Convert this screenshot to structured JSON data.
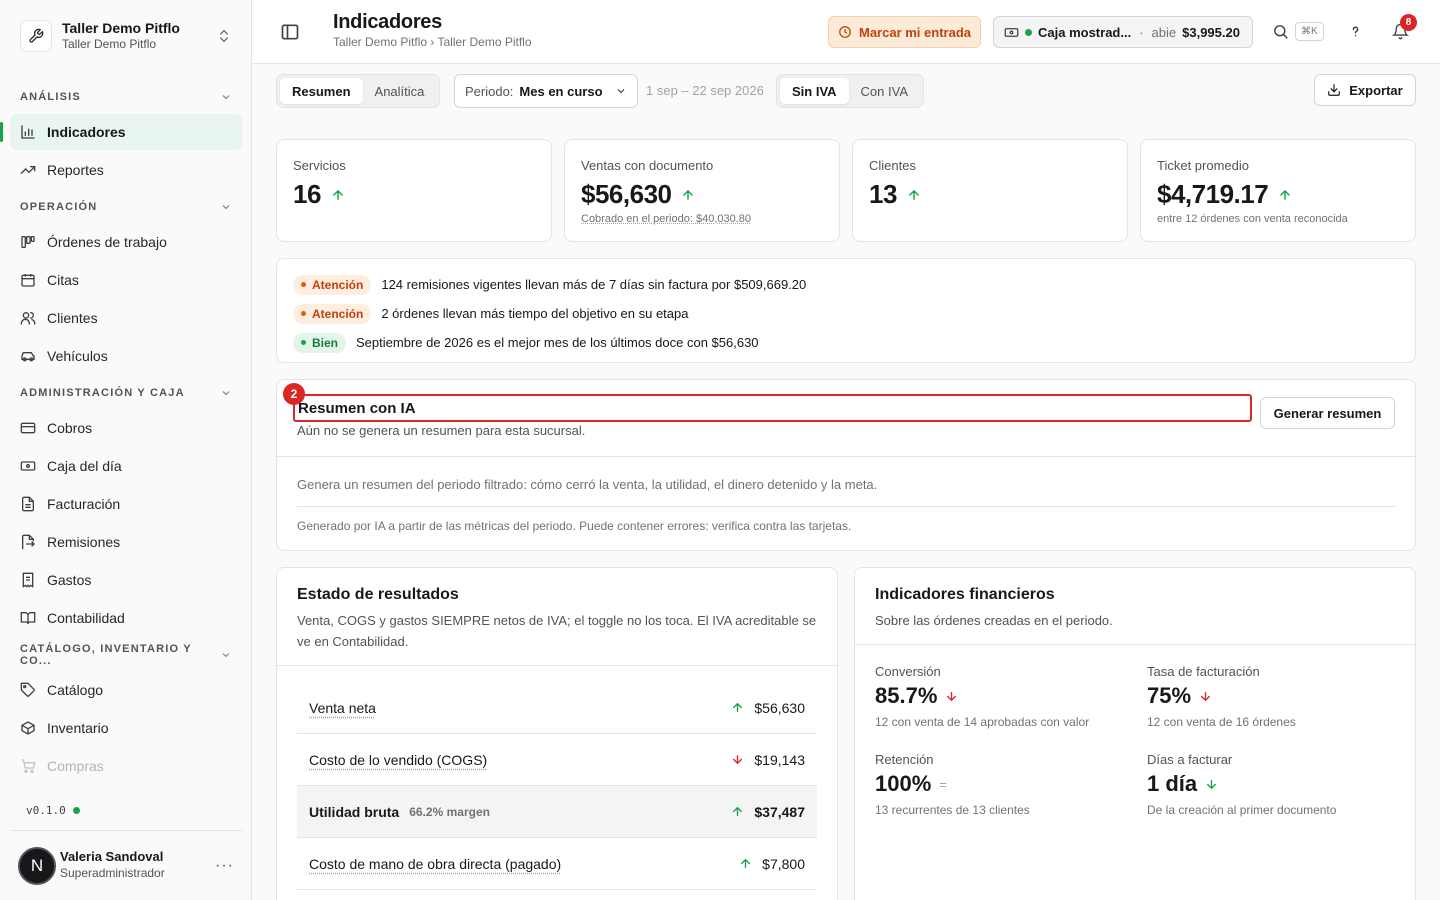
{
  "workspace": {
    "name": "Taller Demo Pitflo",
    "subtitle": "Taller Demo Pitflo"
  },
  "sidebar": {
    "sections": [
      {
        "label": "ANÁLISIS",
        "items": [
          {
            "label": "Indicadores",
            "icon": "bar-chart-icon",
            "active": true
          },
          {
            "label": "Reportes",
            "icon": "trending-up-icon"
          }
        ]
      },
      {
        "label": "OPERACIÓN",
        "items": [
          {
            "label": "Órdenes de trabajo",
            "icon": "kanban-icon"
          },
          {
            "label": "Citas",
            "icon": "calendar-icon"
          },
          {
            "label": "Clientes",
            "icon": "users-icon"
          },
          {
            "label": "Vehículos",
            "icon": "car-icon"
          }
        ]
      },
      {
        "label": "ADMINISTRACIÓN Y CAJA",
        "items": [
          {
            "label": "Cobros",
            "icon": "credit-card-icon"
          },
          {
            "label": "Caja del día",
            "icon": "banknote-icon"
          },
          {
            "label": "Facturación",
            "icon": "file-text-icon"
          },
          {
            "label": "Remisiones",
            "icon": "file-export-icon"
          },
          {
            "label": "Gastos",
            "icon": "receipt-icon"
          },
          {
            "label": "Contabilidad",
            "icon": "book-icon"
          }
        ]
      },
      {
        "label": "CATÁLOGO, INVENTARIO Y CO...",
        "items": [
          {
            "label": "Catálogo",
            "icon": "tag-icon"
          },
          {
            "label": "Inventario",
            "icon": "package-icon"
          },
          {
            "label": "Compras",
            "icon": "cart-icon"
          }
        ]
      }
    ],
    "version": "v0.1.0",
    "user": {
      "initial": "N",
      "name": "Valeria Sandoval",
      "role": "Superadministrador"
    }
  },
  "header": {
    "title": "Indicadores",
    "breadcrumb": "Taller Demo Pitflo › Taller Demo Pitflo",
    "entry_button": "Marcar mi entrada",
    "caja": {
      "name": "Caja mostrad...",
      "separator": "·",
      "status": "abie",
      "amount": "$3,995.20"
    },
    "shortcut": "⌘K",
    "notifications": "8"
  },
  "toolbar": {
    "view_tabs": [
      "Resumen",
      "Analítica"
    ],
    "period_label": "Periodo:",
    "period_value": "Mes en curso",
    "date_range": "1 sep – 22 sep 2026",
    "tax_tabs": [
      "Sin IVA",
      "Con IVA"
    ],
    "export_label": "Exportar"
  },
  "kpis": [
    {
      "label": "Servicios",
      "value": "16",
      "trend": "up",
      "sub": ""
    },
    {
      "label": "Ventas con documento",
      "value": "$56,630",
      "trend": "up",
      "sub": "Cobrado en el periodo: $40,030.80"
    },
    {
      "label": "Clientes",
      "value": "13",
      "trend": "up",
      "sub": ""
    },
    {
      "label": "Ticket promedio",
      "value": "$4,719.17",
      "trend": "up",
      "sub": "entre 12 órdenes con venta reconocida"
    }
  ],
  "alerts": [
    {
      "level": "Atención",
      "kind": "warn",
      "text": "124 remisiones vigentes llevan más de 7 días sin factura por $509,669.20"
    },
    {
      "level": "Atención",
      "kind": "warn",
      "text": "2 órdenes llevan más tiempo del objetivo en su etapa"
    },
    {
      "level": "Bien",
      "kind": "ok",
      "text": "Septiembre de 2026 es el mejor mes de los últimos doce con $56,630"
    }
  ],
  "ai_summary": {
    "marker": "2",
    "title": "Resumen con IA",
    "subtitle": "Aún no se genera un resumen para esta sucursal.",
    "button": "Generar resumen",
    "description": "Genera un resumen del periodo filtrado: cómo cerró la venta, la utilidad, el dinero detenido y la meta.",
    "note": "Generado por IA a partir de las métricas del periodo. Puede contener errores: verifica contra las tarjetas."
  },
  "income_statement": {
    "title": "Estado de resultados",
    "subtitle": "Venta, COGS y gastos SIEMPRE netos de IVA; el toggle no los toca. El IVA acreditable se ve en Contabilidad.",
    "rows": [
      {
        "label": "Venta neta",
        "margin": "",
        "value": "$56,630",
        "trend": "up"
      },
      {
        "label": "Costo de lo vendido (COGS)",
        "margin": "",
        "value": "$19,143",
        "trend": "down"
      },
      {
        "label": "Utilidad bruta",
        "margin": "66.2% margen",
        "value": "$37,487",
        "trend": "up"
      },
      {
        "label": "Costo de mano de obra directa (pagado)",
        "margin": "",
        "value": "$7,800",
        "trend": "up"
      }
    ]
  },
  "financial": {
    "title": "Indicadores financieros",
    "subtitle": "Sobre las órdenes creadas en el periodo.",
    "metrics": [
      {
        "label": "Conversión",
        "value": "85.7%",
        "trend": "down",
        "sub": "12 con venta de 14 aprobadas con valor"
      },
      {
        "label": "Tasa de facturación",
        "value": "75%",
        "trend": "down",
        "sub": "12 con venta de 16 órdenes"
      },
      {
        "label": "Retención",
        "value": "100%",
        "trend": "flat",
        "flat_symbol": "=",
        "sub": "13 recurrentes de 13 clientes"
      },
      {
        "label": "Días a facturar",
        "value": "1 día",
        "trend": "down-good",
        "sub": "De la creación al primer documento"
      }
    ]
  },
  "colors": {
    "accent": "#16a34a",
    "warning": "#c2410c",
    "danger": "#dc2626"
  }
}
